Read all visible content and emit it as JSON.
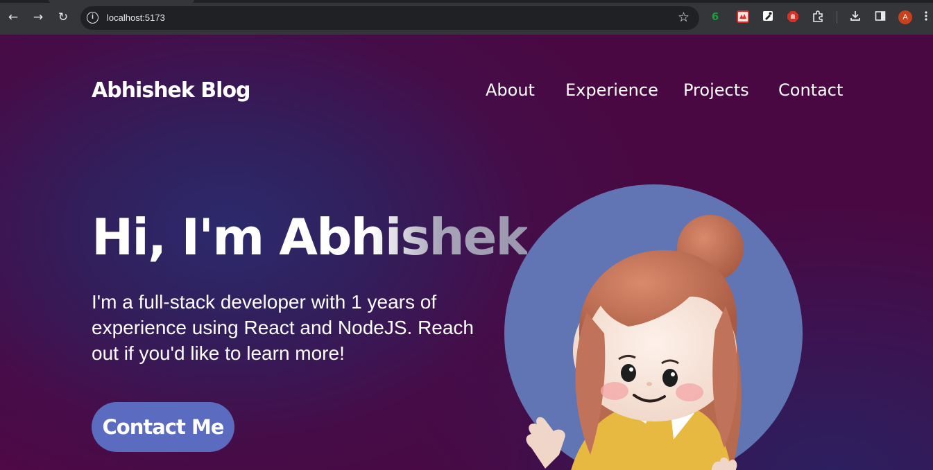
{
  "browser": {
    "url": "localhost:5173",
    "nav": {
      "back_icon": "←",
      "forward_icon": "→",
      "reload_icon": "↻"
    },
    "extensions": [
      {
        "name": "counter-extension",
        "glyph": "6",
        "color": "#1a9e3a"
      },
      {
        "name": "extension-red",
        "glyph": "",
        "color": "#d93025"
      },
      {
        "name": "color-picker-extension",
        "glyph": "",
        "color": "#ffffff"
      },
      {
        "name": "adblock-extension",
        "glyph": "",
        "color": "#d93025"
      },
      {
        "name": "puzzle-extension",
        "glyph": "",
        "color": "#e8eaed"
      }
    ],
    "profile_initial": "A"
  },
  "header": {
    "brand": "Abhishek Blog",
    "nav": [
      "About",
      "Experience",
      "Projects",
      "Contact"
    ]
  },
  "hero": {
    "title": "Hi, I'm Abhishek",
    "description": "I'm a full-stack developer with 1 years of experience using React and NodeJS. Reach out if you'd like to learn more!",
    "cta_label": "Contact Me"
  },
  "colors": {
    "background": "#4a0842",
    "background_glow": "#2a2c6e",
    "button": "#5b6bbf",
    "avatar_circle": "#6175b4"
  }
}
